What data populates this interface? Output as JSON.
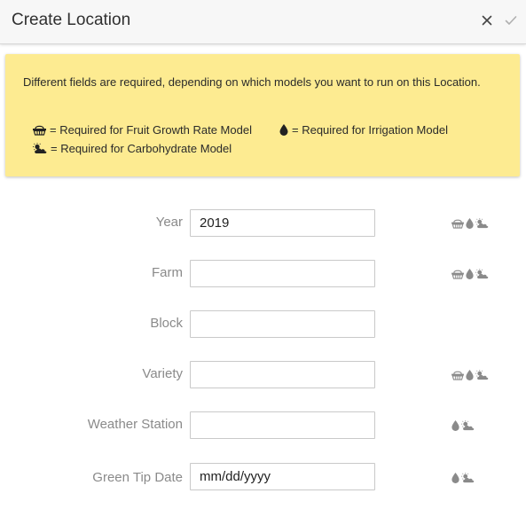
{
  "dialog": {
    "title": "Create Location",
    "close_icon": "close-icon",
    "save_icon": "checkmark-icon"
  },
  "notice": {
    "text": "Different fields are required, depending on which models you want to run on this Location.",
    "legend": [
      {
        "icon": "basket-icon",
        "label": "= Required for Fruit Growth Rate Model"
      },
      {
        "icon": "water-drop-icon",
        "label": "= Required for Irrigation Model"
      },
      {
        "icon": "sun-cloud-icon",
        "label": "= Required for Carbohydrate Model"
      }
    ],
    "background_color": "#fdeb91"
  },
  "form": {
    "fields": [
      {
        "label": "Year",
        "value": "2019",
        "placeholder": "",
        "models": [
          "basket-icon",
          "water-drop-icon",
          "sun-cloud-icon"
        ]
      },
      {
        "label": "Farm",
        "value": "",
        "placeholder": "",
        "models": [
          "basket-icon",
          "water-drop-icon",
          "sun-cloud-icon"
        ]
      },
      {
        "label": "Block",
        "value": "",
        "placeholder": "",
        "models": []
      },
      {
        "label": "Variety",
        "value": "",
        "placeholder": "",
        "models": [
          "basket-icon",
          "water-drop-icon",
          "sun-cloud-icon"
        ]
      },
      {
        "label": "Weather Station",
        "value": "",
        "placeholder": "",
        "models": [
          "water-drop-icon",
          "sun-cloud-icon"
        ]
      },
      {
        "label": "Green Tip Date",
        "value": "mm/dd/yyyy",
        "placeholder": "mm/dd/yyyy",
        "models": [
          "water-drop-icon",
          "sun-cloud-icon"
        ]
      }
    ]
  }
}
